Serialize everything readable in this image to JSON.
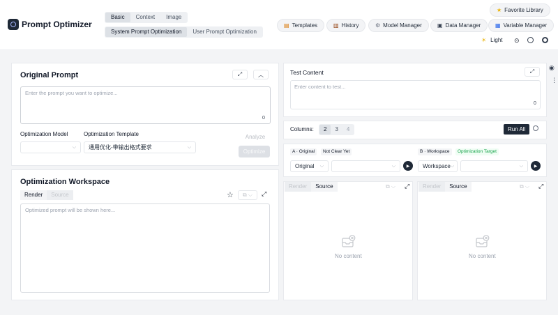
{
  "app": {
    "title": "Prompt Optimizer"
  },
  "mode_tabs": [
    {
      "label": "Basic",
      "active": true
    },
    {
      "label": "Context",
      "active": false
    },
    {
      "label": "Image",
      "active": false
    }
  ],
  "sub_tabs": [
    {
      "label": "System Prompt Optimization",
      "active": true
    },
    {
      "label": "User Prompt Optimization",
      "active": false
    }
  ],
  "header": {
    "favorite": {
      "label": "Favorite Library",
      "icon": "star-icon"
    },
    "nav": [
      {
        "label": "Templates",
        "icon": "memo-icon"
      },
      {
        "label": "History",
        "icon": "scroll-icon"
      },
      {
        "label": "Model Manager",
        "icon": "gear-icon"
      },
      {
        "label": "Data Manager",
        "icon": "floppy-icon"
      },
      {
        "label": "Variable Manager",
        "icon": "numbers-icon"
      }
    ],
    "theme_label": "Light"
  },
  "original_prompt": {
    "title": "Original Prompt",
    "placeholder": "Enter the prompt you want to optimize...",
    "count": "0",
    "model_label": "Optimization Model",
    "model_value": "",
    "template_label": "Optimization Template",
    "template_value": "通用优化-带输出格式要求",
    "analyze_label": "Analyze",
    "optimize_label": "Optimize"
  },
  "workspace": {
    "title": "Optimization Workspace",
    "tabs": [
      "Render",
      "Source"
    ],
    "placeholder": "Optimized prompt will be shown here..."
  },
  "test": {
    "title": "Test Content",
    "placeholder": "Enter content to test...",
    "count": "0",
    "columns_label": "Columns:",
    "columns": [
      "2",
      "3",
      "4"
    ],
    "run_all": "Run All"
  },
  "column_a": {
    "tag": "A · Original",
    "tag2": "Not Clear Yet",
    "select1": "Original",
    "select2": "",
    "tabs": [
      "Render",
      "Source"
    ],
    "empty": "No content"
  },
  "column_b": {
    "tag": "B · Workspace",
    "tag2": "Optimization Target",
    "select1": "Workspace",
    "select2": "",
    "tabs": [
      "Render",
      "Source"
    ],
    "empty": "No content"
  },
  "colors": {
    "accent": "#1f2937",
    "green": "#16a34a",
    "border": "#e5e7eb"
  }
}
